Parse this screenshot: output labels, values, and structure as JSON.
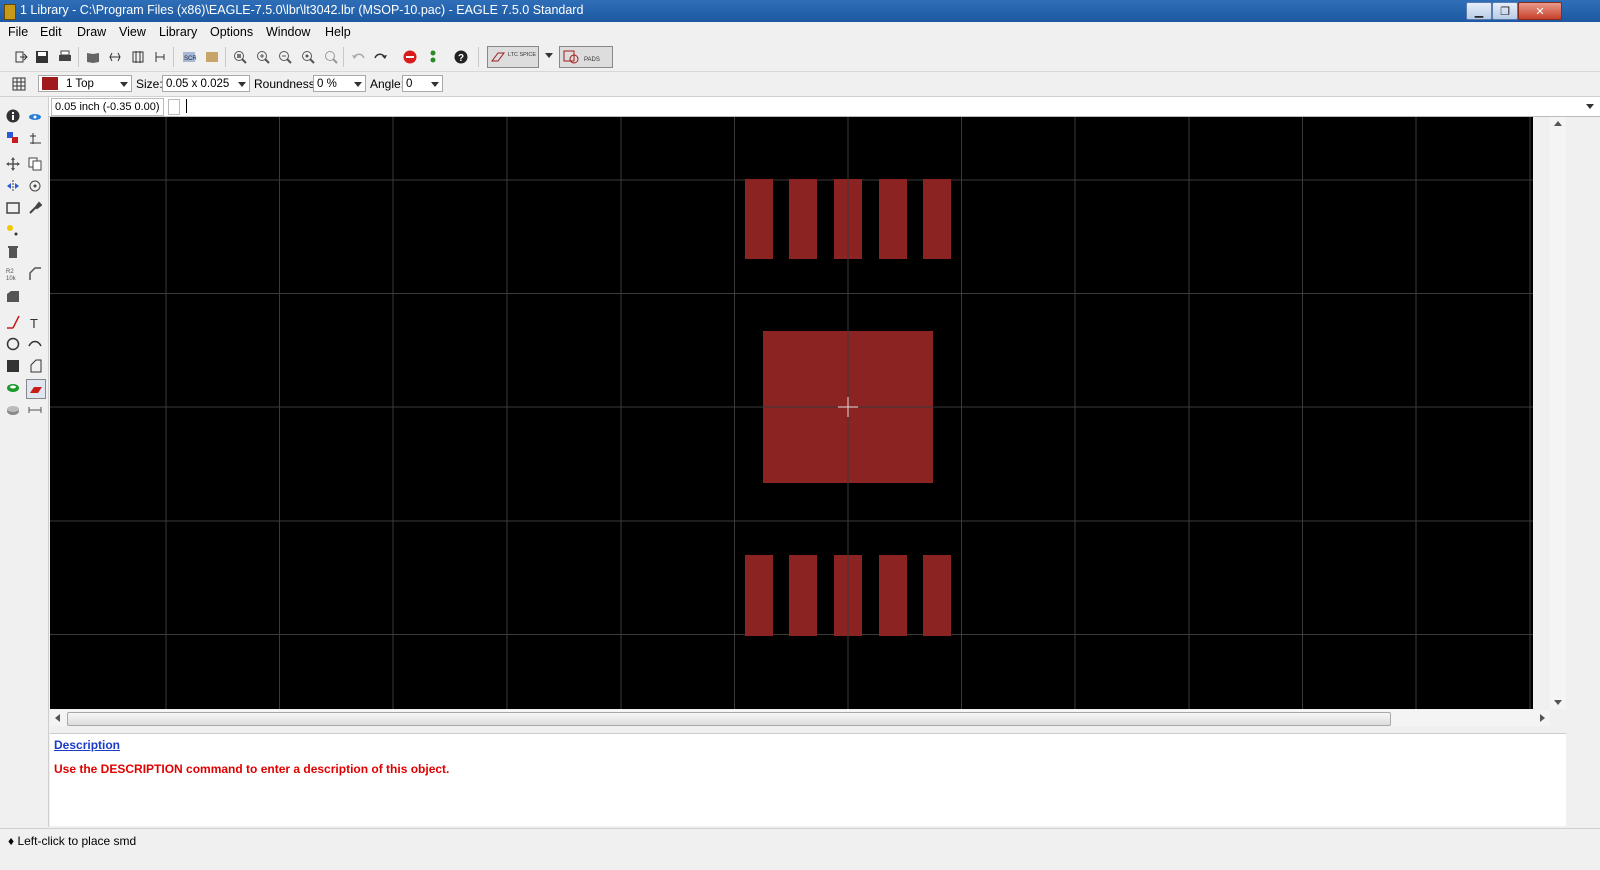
{
  "window": {
    "title": "1 Library - C:\\Program Files (x86)\\EAGLE-7.5.0\\lbr\\lt3042.lbr (MSOP-10.pac) - EAGLE 7.5.0 Standard"
  },
  "menu": [
    "File",
    "Edit",
    "Draw",
    "View",
    "Library",
    "Options",
    "Window",
    "Help"
  ],
  "toolbar2": {
    "layer": "1 Top",
    "layer_color": "#a01b1b",
    "size_label": "Size:",
    "size_value": "0.05 x 0.025",
    "roundness_label": "Roundness:",
    "roundness_value": "0 %",
    "angle_label": "Angle:",
    "angle_value": "0"
  },
  "toolbar1_plugins": {
    "ltspice": "LTC SPICE",
    "pads": "PADS"
  },
  "command_line": {
    "coordinate": "0.05 inch (-0.35 0.00)",
    "value": ""
  },
  "canvas": {
    "background": "#000000",
    "pad_color": "#8b2323",
    "grid_color": "#3a3a3a"
  },
  "description": {
    "title": "Description",
    "text": "Use the DESCRIPTION command to enter a description of this object."
  },
  "status": {
    "text": "♦ Left-click to place smd"
  }
}
